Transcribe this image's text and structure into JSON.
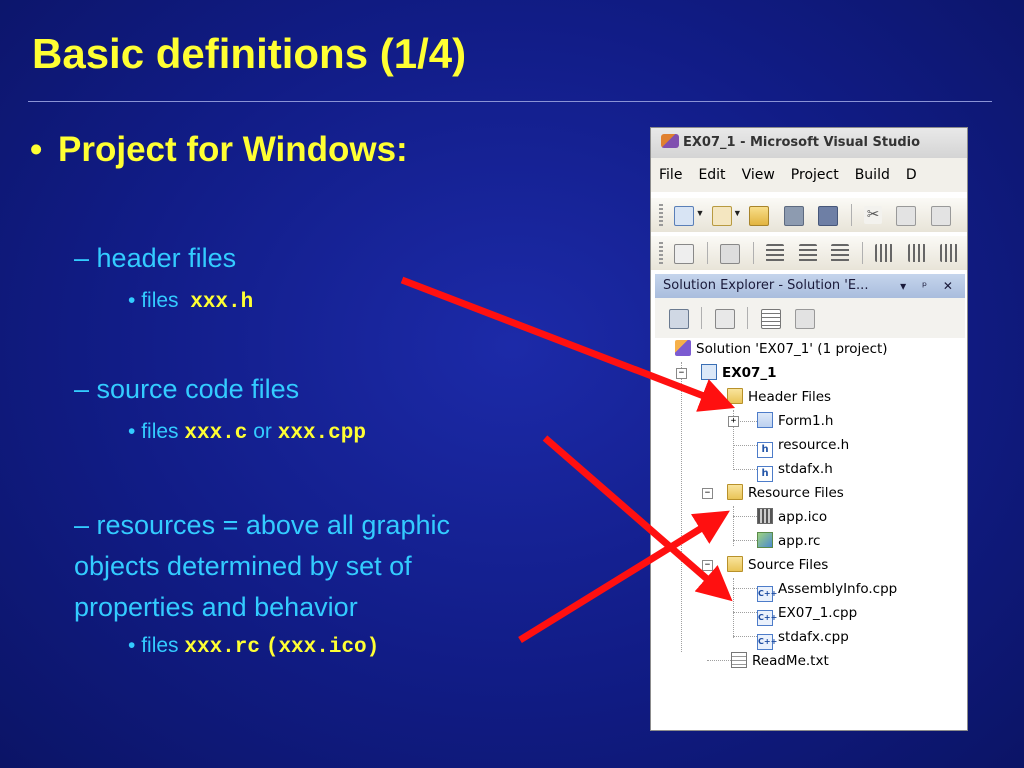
{
  "slide": {
    "title": "Basic definitions (1/4)",
    "bullet_marker": "•",
    "main_bullet": "Project for Windows:",
    "items": [
      {
        "dash": "– ",
        "label": "header files",
        "detail": {
          "marker": "• ",
          "text": "files ",
          "code1": "xxx.h",
          "join": "",
          "code2": ""
        }
      },
      {
        "dash": "– ",
        "label": "source code files",
        "detail": {
          "marker": "• ",
          "text": "files ",
          "code1": "xxx.c",
          "join": " or ",
          "code2": "xxx.cpp"
        }
      },
      {
        "dash": "– ",
        "label_lines": [
          "resources = above all graphic",
          "objects determined by set of",
          "properties and behavior"
        ],
        "detail": {
          "marker": "• ",
          "text": "files ",
          "code1": "xxx.rc",
          "join": " ",
          "code2": "(xxx.ico)"
        }
      }
    ]
  },
  "vs_window": {
    "title": "EX07_1 - Microsoft Visual Studio",
    "menu": [
      "File",
      "Edit",
      "View",
      "Project",
      "Build",
      "D"
    ],
    "solution_explorer": {
      "title": "Solution Explorer - Solution 'E...",
      "controls": "▾ ᵖ ✕",
      "tree": [
        {
          "label": "Solution 'EX07_1' (1 project)",
          "icon": "solution-icon"
        },
        {
          "label": "EX07_1",
          "icon": "project-icon",
          "bold": true
        },
        {
          "label": "Header Files",
          "icon": "folder-icon"
        },
        {
          "label": "Form1.h",
          "icon": "form-icon"
        },
        {
          "label": "resource.h",
          "icon": "header-file-icon"
        },
        {
          "label": "stdafx.h",
          "icon": "header-file-icon"
        },
        {
          "label": "Resource Files",
          "icon": "folder-icon"
        },
        {
          "label": "app.ico",
          "icon": "ico-file-icon"
        },
        {
          "label": "app.rc",
          "icon": "rc-file-icon"
        },
        {
          "label": "Source Files",
          "icon": "folder-icon"
        },
        {
          "label": "AssemblyInfo.cpp",
          "icon": "cpp-file-icon"
        },
        {
          "label": "EX07_1.cpp",
          "icon": "cpp-file-icon"
        },
        {
          "label": "stdafx.cpp",
          "icon": "cpp-file-icon"
        },
        {
          "label": "ReadMe.txt",
          "icon": "text-file-icon"
        }
      ]
    }
  },
  "colors": {
    "title": "#ffff33",
    "subtext": "#33ccff",
    "arrow": "#ff1010",
    "background": "#111c86"
  }
}
